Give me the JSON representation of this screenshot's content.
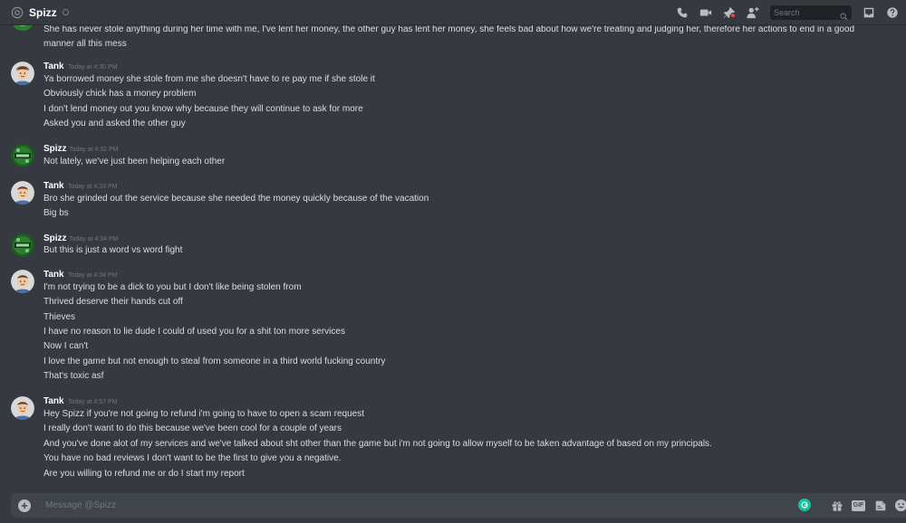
{
  "header": {
    "channel_name": "Spizz",
    "search_placeholder": "Search"
  },
  "messages": {
    "continuation": "She has never stole anything during her time with me, I've lent her money, the other guy has lent her money, she feels bad about how we're treating and judging her, therefore her actions to end in a good manner all this mess",
    "groups": [
      {
        "author": "Tank",
        "time": "Today at 4:30 PM",
        "lines": [
          "Ya borrowed money she stole from me she doesn't have to re pay me if she stole it",
          "Obviously chick has a money problem",
          "I don't lend money out you know why because they will continue to ask for  more",
          "Asked you and asked the other guy"
        ]
      },
      {
        "author": "Spizz",
        "time": "Today at 4:32 PM",
        "lines": [
          "Not lately, we've just been helping each other"
        ]
      },
      {
        "author": "Tank",
        "time": "Today at 4:33 PM",
        "lines": [
          "Bro she grinded out the service because she needed the money quickly because of the vacation",
          "Big bs"
        ]
      },
      {
        "author": "Spizz",
        "time": "Today at 4:34 PM",
        "lines": [
          "But this is just a word vs word fight"
        ]
      },
      {
        "author": "Tank",
        "time": "Today at 4:34 PM",
        "lines": [
          "I'm not trying to be a dick to you but I don't like being stolen from",
          "Thrived deserve their hands cut off",
          "Thieves",
          "I have no reason to lie dude I could of used you for a shit ton more services",
          "Now I can't",
          "I love the game but not enough to steal from someone in a third world fucking country",
          "That's toxic asf"
        ]
      },
      {
        "author": "Tank",
        "time": "Today at 4:57 PM",
        "lines": [
          "Hey Spizz if you're not going to refund i'm going to have to open a scam request",
          "I really don't want to do this because we've been cool for a couple of years",
          "And you've done alot of my services and we've talked about sht other than the game but i'm not going to allow myself to be taken advantage of based on my principals.",
          "You have no bad reviews I don't want to be the first to give you a negative.",
          "Are you willing to refund me or do I start my report"
        ]
      }
    ]
  },
  "composer": {
    "placeholder": "Message @Spizz",
    "gif_label": "GIF"
  },
  "colors": {
    "background": "#36393f",
    "composer": "#40444b",
    "grammarly": "#15c39a"
  }
}
